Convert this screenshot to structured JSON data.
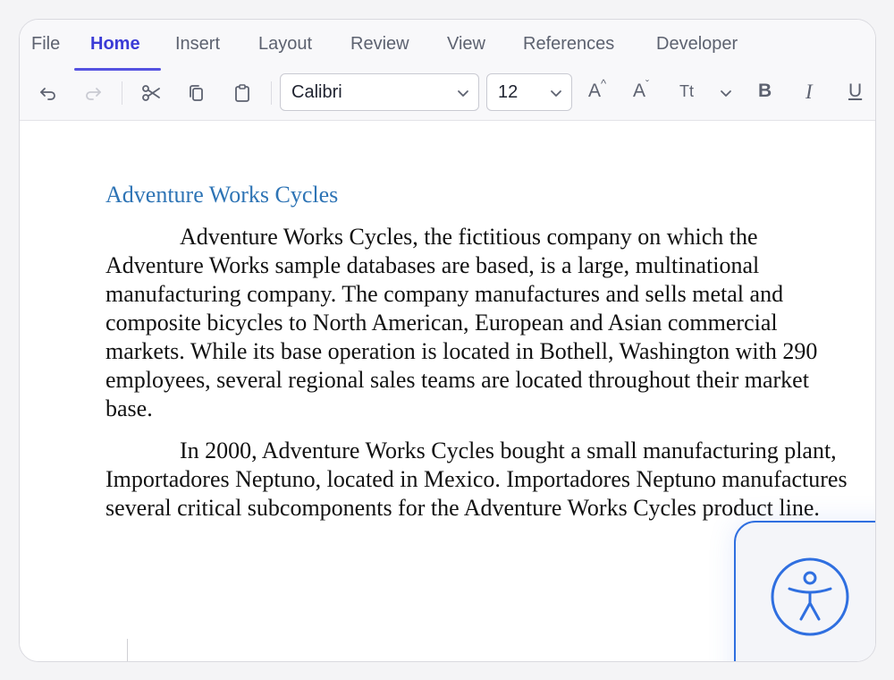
{
  "tabs": [
    {
      "label": "File",
      "active": false
    },
    {
      "label": "Home",
      "active": true
    },
    {
      "label": "Insert",
      "active": false
    },
    {
      "label": "Layout",
      "active": false
    },
    {
      "label": "Review",
      "active": false
    },
    {
      "label": "View",
      "active": false
    },
    {
      "label": "References",
      "active": false
    },
    {
      "label": "Developer",
      "active": false
    }
  ],
  "toolbar": {
    "font_name": "Calibri",
    "font_size": "12",
    "grow_font_label": "A",
    "shrink_font_label": "A",
    "text_case_label": "Tt",
    "bold_label": "B",
    "italic_label": "I",
    "underline_label": "U"
  },
  "document": {
    "heading": "Adventure Works Cycles",
    "paragraphs": [
      "Adventure Works Cycles, the fictitious company on which the Adventure Works sample databases are based, is a large, multinational manufacturing company. The company manufactures and sells metal and composite bicycles to North American, European and Asian commercial markets. While its base operation is located in Bothell, Washington with 290 employees, several regional sales teams are located throughout their market base.",
      "In 2000, Adventure Works Cycles bought a small manufacturing plant, Importadores Neptuno, located in Mexico. Importadores Neptuno manufactures several critical subcomponents for the Adventure Works Cycles product line."
    ]
  },
  "colors": {
    "accent": "#3b3bd6",
    "heading": "#2e74b5",
    "a11y": "#2f6fe0"
  },
  "icons": [
    "undo-icon",
    "redo-icon",
    "cut-icon",
    "copy-icon",
    "paste-icon",
    "chevron-down-icon",
    "accessibility-icon"
  ]
}
